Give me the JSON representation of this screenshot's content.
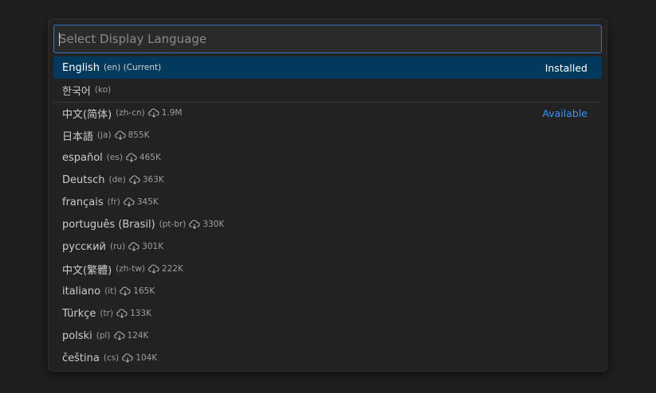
{
  "search": {
    "placeholder": "Select Display Language"
  },
  "colors": {
    "background": "#1f1f1f",
    "panel": "#222222",
    "input_border": "#3574c4",
    "selected_row": "#04395e",
    "installed_label": "#ffffff",
    "available_label": "#3794ff",
    "secondary_text": "#9d9d9d"
  },
  "groups": {
    "installed_label": "Installed",
    "available_label": "Available"
  },
  "installed": [
    {
      "name": "English",
      "code": "(en) (Current)",
      "selected": true
    },
    {
      "name": "한국어",
      "code": "(ko)",
      "selected": false
    }
  ],
  "available": [
    {
      "name": "中文(简体)",
      "code": "(zh-cn)",
      "icon": "cloud-download-icon",
      "size": "1.9M"
    },
    {
      "name": "日本語",
      "code": "(ja)",
      "icon": "cloud-download-icon",
      "size": "855K"
    },
    {
      "name": "español",
      "code": "(es)",
      "icon": "cloud-download-icon",
      "size": "465K"
    },
    {
      "name": "Deutsch",
      "code": "(de)",
      "icon": "cloud-download-icon",
      "size": "363K"
    },
    {
      "name": "français",
      "code": "(fr)",
      "icon": "cloud-download-icon",
      "size": "345K"
    },
    {
      "name": "português (Brasil)",
      "code": "(pt-br)",
      "icon": "cloud-download-icon",
      "size": "330K"
    },
    {
      "name": "русский",
      "code": "(ru)",
      "icon": "cloud-download-icon",
      "size": "301K"
    },
    {
      "name": "中文(繁體)",
      "code": "(zh-tw)",
      "icon": "cloud-download-icon",
      "size": "222K"
    },
    {
      "name": "italiano",
      "code": "(it)",
      "icon": "cloud-download-icon",
      "size": "165K"
    },
    {
      "name": "Türkçe",
      "code": "(tr)",
      "icon": "cloud-download-icon",
      "size": "133K"
    },
    {
      "name": "polski",
      "code": "(pl)",
      "icon": "cloud-download-icon",
      "size": "124K"
    },
    {
      "name": "čeština",
      "code": "(cs)",
      "icon": "cloud-download-icon",
      "size": "104K"
    }
  ]
}
